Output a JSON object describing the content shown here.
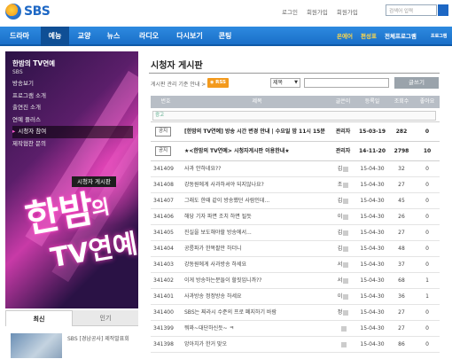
{
  "header": {
    "logo_text": "SBS",
    "links": [
      "로그인",
      "회원가입",
      "회원가입"
    ],
    "search_placeholder": "검색어 입력"
  },
  "nav": {
    "items": [
      "드라마",
      "예능",
      "교양",
      "뉴스",
      "라디오",
      "다시보기",
      "콘팅"
    ],
    "active_index": 1,
    "right_items": [
      "온에어",
      "편성표",
      "전체프로그램",
      "프로그램"
    ]
  },
  "sidebar": {
    "title": "한밤의 TV연예",
    "subtitle": "SBS",
    "menu": [
      "방송보기",
      "프로그램 소개",
      "출연진 소개",
      "연예 플러스",
      "시청자 참여",
      "제작협찬 문의"
    ],
    "active_menu_index": 4,
    "submenu_label": "시청자 게시판",
    "art_text_1": "한밤",
    "art_text_2": "의",
    "art_text_3": "TV연예",
    "tabs": [
      "최신",
      "인기"
    ],
    "news_text": "SBS [경남공사] 제작발표회"
  },
  "main": {
    "page_title": "시청자 게시판",
    "toolbar_label": "게시판 관리 기준 안내 >",
    "rss_label": "RSS",
    "select_value": "제목",
    "search_button": "글쓰기",
    "ad_label": "광고",
    "columns": [
      "번호",
      "제목",
      "글쓴이",
      "등록일",
      "조회수",
      "좋아요"
    ],
    "notices": [
      {
        "badge": "공지",
        "title": "[한밤의 TV연예] 방송 시간 변경 안내 | 수요일 밤 11시 15분",
        "author": "관리자",
        "date": "15-03-19",
        "views": "282",
        "likes": "0"
      },
      {
        "badge": "공지",
        "title": "★<한밤의 TV연예> 시청자게시판 이용한내★",
        "author": "관리자",
        "date": "14-11-20",
        "views": "2798",
        "likes": "10"
      }
    ],
    "rows": [
      {
        "no": "341409",
        "title": "사과 안하네요??",
        "author": "김",
        "date": "15-04-30",
        "views": "32",
        "likes": "0"
      },
      {
        "no": "341408",
        "title": "강동원에게 사과하셔야 되지않나요?",
        "author": "조",
        "date": "15-04-30",
        "views": "27",
        "likes": "0"
      },
      {
        "no": "341407",
        "title": "그래도 한때 같이 방송했던 사람인데...",
        "author": "김",
        "date": "15-04-30",
        "views": "45",
        "likes": "0"
      },
      {
        "no": "341406",
        "title": "해당 기자 파면 조치 하면 될듯",
        "author": "이",
        "date": "15-04-30",
        "views": "26",
        "likes": "0"
      },
      {
        "no": "341405",
        "title": "진실을 보도해야할 방송에서...",
        "author": "김",
        "date": "15-04-30",
        "views": "27",
        "likes": "0"
      },
      {
        "no": "341404",
        "title": "공릉파가 한목팔만 하더니",
        "author": "김",
        "date": "15-04-30",
        "views": "48",
        "likes": "0"
      },
      {
        "no": "341403",
        "title": "강동원에게 사과방송 하세요",
        "author": "서",
        "date": "15-04-30",
        "views": "37",
        "likes": "0"
      },
      {
        "no": "341402",
        "title": "이게 방송하는분들이 할짓입니까??",
        "author": "서",
        "date": "15-04-30",
        "views": "68",
        "likes": "1"
      },
      {
        "no": "341401",
        "title": "사과방송 정정방송 하세요",
        "author": "이",
        "date": "15-04-30",
        "views": "36",
        "likes": "1"
      },
      {
        "no": "341400",
        "title": "SBS는 찌라시 수준의 프로 폐지하기 바람",
        "author": "정",
        "date": "15-04-30",
        "views": "27",
        "likes": "0"
      },
      {
        "no": "341399",
        "title": "뭐꽈~대단하신듯~ ㅋ",
        "author": "",
        "date": "15-04-30",
        "views": "27",
        "likes": "0"
      },
      {
        "no": "341398",
        "title": "앙아치가 한거 맞오",
        "author": "",
        "date": "15-04-30",
        "views": "86",
        "likes": "0"
      }
    ]
  }
}
